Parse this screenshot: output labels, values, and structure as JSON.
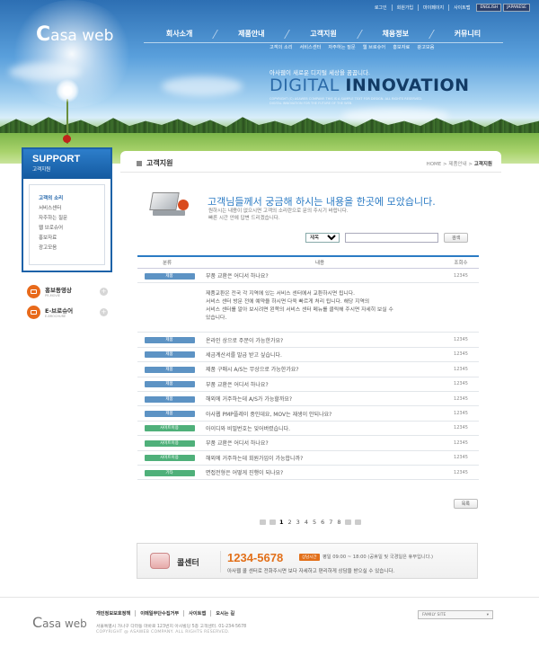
{
  "header": {
    "logo_c": "C",
    "logo_text": "asa web",
    "util_links": [
      "로그인",
      "회원가입",
      "마이페이지",
      "사이트맵"
    ],
    "lang": [
      "ENGLISH",
      "JAPANESE"
    ],
    "gnb": [
      "회사소개",
      "제품안내",
      "고객지원",
      "채용정보",
      "커뮤니티"
    ],
    "active_gnb": "고객지원",
    "subnav": [
      "고객의 소리",
      "서비스센터",
      "자주하는 질문",
      "웹 브로슈어",
      "홍보자료",
      "광고모음"
    ],
    "tagline": "아사웹이 새로운 디지털 세상을 꿈꿉니다.",
    "hero_word1": "DIGITAL",
    "hero_word2": "INNOVATION",
    "hero_small": "COPYRIGHT (C) ASAWEB COMPANY. THIS IS A SAMPLE TEXT FOR DESIGN. ALL RIGHTS RESERVED. DIGITAL INNOVATION FOR THE FUTURE OF THE WEB."
  },
  "sidebar": {
    "title": "SUPPORT",
    "subtitle": "고객지원",
    "items": [
      "고객의 소리",
      "서비스센터",
      "자주하는 질문",
      "웹 브로슈어",
      "홍보자료",
      "광고모음"
    ],
    "active": "고객의 소리",
    "promos": [
      {
        "label": "홍보동영상",
        "sub": "PR-MOVIE"
      },
      {
        "label": "E-브로슈어",
        "sub": "E-BROCHURE"
      }
    ]
  },
  "content": {
    "title": "고객지원",
    "breadcrumb": [
      "HOME",
      "제품안내",
      "고객지원"
    ],
    "intro_heading": "고객님들께서 궁금해 하시는 내용을 한곳에 모았습니다.",
    "intro_line1": "원하시는 내용이 없으시면 고객의 소리란으로 문의 주시기 바랍니다.",
    "intro_line2": "빠른 시간 안에 답변 드리겠습니다.",
    "search": {
      "select_value": "제목",
      "input_value": "",
      "button": "검색"
    },
    "table_headers": [
      "분류",
      "내용",
      "조회수"
    ],
    "answer": [
      "제품교환은 전국 각 지역에 있는 서비스 센터에서 교환하시면 됩니다.",
      "서비스 센터 방문 전에 예약을 하시면 다욱 빠르게 처리 됩니다. 해당 지역의",
      "서비스 센터를 알아 보시려면 왼쪽의 서비스 센터 메뉴를 클릭해 주시면 자세히 보실 수",
      "있습니다."
    ],
    "rows": [
      {
        "cat": "제품",
        "q": "부품 교환은 어디서 하나요?",
        "views": "12345",
        "color": "blue"
      },
      {
        "cat": "제품",
        "q": "온라인 상으로 주문이 가능한가요?",
        "views": "12345",
        "color": "blue"
      },
      {
        "cat": "제품",
        "q": "세금계산서를 발급 받고 싶습니다.",
        "views": "12345",
        "color": "blue"
      },
      {
        "cat": "제품",
        "q": "제품 구매시 A/S는 무상으로 가능한가요?",
        "views": "12345",
        "color": "blue"
      },
      {
        "cat": "제품",
        "q": "부품 교환은 어디서 하나요?",
        "views": "12345",
        "color": "blue"
      },
      {
        "cat": "제품",
        "q": "해외에 거주하는데 A/S가 가능할까요?",
        "views": "12345",
        "color": "blue"
      },
      {
        "cat": "제품",
        "q": "아사웹 PMP플레이 중인데요, MOV는 재생이 안되나요?",
        "views": "12345",
        "color": "blue"
      },
      {
        "cat": "사이트이용",
        "q": "아이디와 비밀번호는 잊어버렸습니다.",
        "views": "12345",
        "color": "green"
      },
      {
        "cat": "사이트이용",
        "q": "부품 교환은 어디서 하나요?",
        "views": "12345",
        "color": "green"
      },
      {
        "cat": "사이트이용",
        "q": "해외에 거주하는데 회원가입이 가능합니까?",
        "views": "12345",
        "color": "green"
      },
      {
        "cat": "기타",
        "q": "면접전형은 어떻게 진행이 되나요?",
        "views": "12345",
        "color": "green"
      }
    ],
    "list_button": "목록",
    "pages": [
      "1",
      "2",
      "3",
      "4",
      "5",
      "6",
      "7",
      "8"
    ],
    "current_page": "1",
    "call": {
      "title": "콜센터",
      "number": "1234-5678",
      "badge": "상담시간",
      "hours": "평일 09:00 ~ 18:00 (공휴일 및 국경일은 휴무입니다.)",
      "desc": "아사웹 콜 센터로 전화주시면 보다 자세하고 편리하게 상담을 받으실 수 있습니다."
    }
  },
  "footer": {
    "logo_c": "C",
    "logo_text": "asa web",
    "links": [
      "개인정보보호정책",
      "이메일무단수집거부",
      "사이트맵",
      "오시는 길"
    ],
    "address": "서울특별시 가나구 다라동 마바로 123번지 아사빌딩 5층   고객센터. 01-234-5678",
    "copyright": "COPYRIGHT @ ASAWEB COMPANY. ALL RIGHTS RESERVED.",
    "family_site": "FAMILY SITE"
  }
}
